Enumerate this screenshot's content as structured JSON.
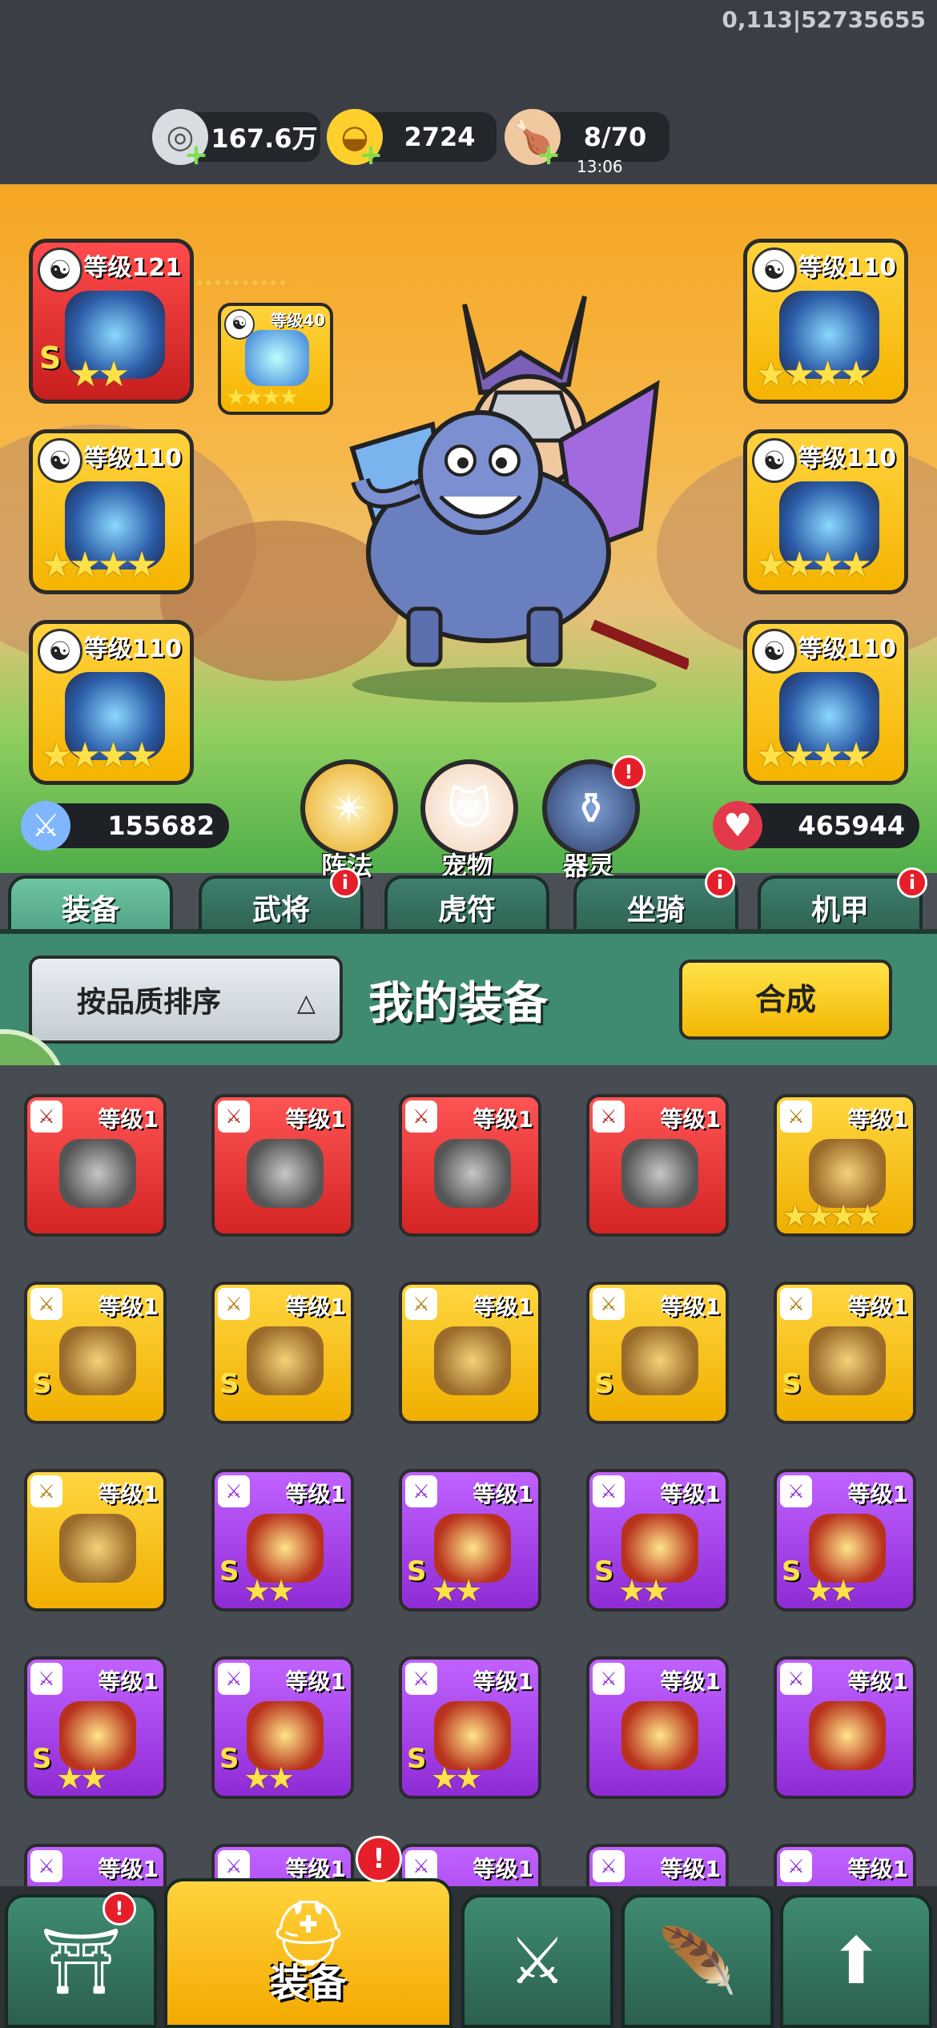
{
  "status": {
    "coords": "0,113|52735655"
  },
  "resources": [
    {
      "name": "silver",
      "icon": "silver-coin-icon",
      "value": "167.6万"
    },
    {
      "name": "gold",
      "icon": "gold-ingot-icon",
      "value": "2724"
    },
    {
      "name": "stamina",
      "icon": "meat-icon",
      "value": "8/70",
      "timer": "13:06"
    }
  ],
  "hero_slots": {
    "left": [
      {
        "level": "等级121",
        "quality": "red",
        "stars": "★★",
        "grade": "S"
      },
      {
        "level": "等级110",
        "quality": "gold",
        "stars": "★★★★",
        "grade": ""
      },
      {
        "level": "等级110",
        "quality": "gold",
        "stars": "★★★★",
        "grade": ""
      }
    ],
    "right": [
      {
        "level": "等级110",
        "quality": "gold",
        "stars": "★★★★",
        "grade": ""
      },
      {
        "level": "等级110",
        "quality": "gold",
        "stars": "★★★★",
        "grade": ""
      },
      {
        "level": "等级110",
        "quality": "gold",
        "stars": "★★★★",
        "grade": ""
      }
    ],
    "mini": {
      "level": "等级40",
      "stars": "★★★★"
    }
  },
  "stats": {
    "attack": "155682",
    "hp": "465944"
  },
  "circle_buttons": [
    {
      "label": "阵法",
      "icon": "formation-icon",
      "badge": false
    },
    {
      "label": "宠物",
      "icon": "cat-pet-icon",
      "badge": false
    },
    {
      "label": "器灵",
      "icon": "spirit-icon",
      "badge": true
    }
  ],
  "tabs": [
    {
      "label": "装备",
      "active": true,
      "badge": false
    },
    {
      "label": "武将",
      "active": false,
      "badge": true
    },
    {
      "label": "虎符",
      "active": false,
      "badge": false
    },
    {
      "label": "坐骑",
      "active": false,
      "badge": true
    },
    {
      "label": "机甲",
      "active": false,
      "badge": true
    }
  ],
  "panel": {
    "sort_label": "按品质排序",
    "title": "我的装备",
    "synth_label": "合成"
  },
  "items": [
    [
      {
        "quality": "red",
        "level": "等级1",
        "grade": "",
        "stars": ""
      },
      {
        "quality": "red",
        "level": "等级1",
        "grade": "",
        "stars": ""
      },
      {
        "quality": "red",
        "level": "等级1",
        "grade": "",
        "stars": ""
      },
      {
        "quality": "red",
        "level": "等级1",
        "grade": "",
        "stars": ""
      },
      {
        "quality": "gold",
        "level": "等级1",
        "grade": "",
        "stars": "★★★★"
      }
    ],
    [
      {
        "quality": "gold",
        "level": "等级1",
        "grade": "S",
        "stars": ""
      },
      {
        "quality": "gold",
        "level": "等级1",
        "grade": "S",
        "stars": ""
      },
      {
        "quality": "gold",
        "level": "等级1",
        "grade": "",
        "stars": ""
      },
      {
        "quality": "gold",
        "level": "等级1",
        "grade": "S",
        "stars": ""
      },
      {
        "quality": "gold",
        "level": "等级1",
        "grade": "S",
        "stars": ""
      }
    ],
    [
      {
        "quality": "gold",
        "level": "等级1",
        "grade": "",
        "stars": ""
      },
      {
        "quality": "purple",
        "level": "等级1",
        "grade": "S",
        "stars": "★★"
      },
      {
        "quality": "purple",
        "level": "等级1",
        "grade": "S",
        "stars": "★★"
      },
      {
        "quality": "purple",
        "level": "等级1",
        "grade": "S",
        "stars": "★★"
      },
      {
        "quality": "purple",
        "level": "等级1",
        "grade": "S",
        "stars": "★★"
      }
    ],
    [
      {
        "quality": "purple",
        "level": "等级1",
        "grade": "S",
        "stars": "★★"
      },
      {
        "quality": "purple",
        "level": "等级1",
        "grade": "S",
        "stars": "★★"
      },
      {
        "quality": "purple",
        "level": "等级1",
        "grade": "S",
        "stars": "★★"
      },
      {
        "quality": "purple",
        "level": "等级1",
        "grade": "",
        "stars": ""
      },
      {
        "quality": "purple",
        "level": "等级1",
        "grade": "",
        "stars": ""
      }
    ],
    [
      {
        "quality": "purple",
        "level": "等级1",
        "grade": "",
        "stars": ""
      },
      {
        "quality": "purple",
        "level": "等级1",
        "grade": "",
        "stars": ""
      },
      {
        "quality": "purple",
        "level": "等级1",
        "grade": "",
        "stars": ""
      },
      {
        "quality": "purple",
        "level": "等级1",
        "grade": "",
        "stars": ""
      },
      {
        "quality": "purple",
        "level": "等级1",
        "grade": "",
        "stars": ""
      }
    ]
  ],
  "bottom_nav": [
    {
      "icon": "palace-icon",
      "label": "",
      "active": false,
      "badge": true
    },
    {
      "icon": "helmet-icon",
      "label": "装备",
      "active": true,
      "badge": true
    },
    {
      "icon": "weapons-icon",
      "label": "",
      "active": false,
      "badge": false
    },
    {
      "icon": "feather-quill-icon",
      "label": "",
      "active": false,
      "badge": false
    },
    {
      "icon": "gold-upgrade-icon",
      "label": "",
      "active": false,
      "badge": false
    }
  ]
}
